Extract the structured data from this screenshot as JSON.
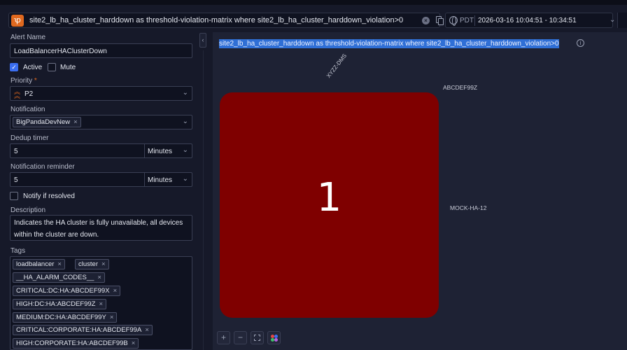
{
  "query": {
    "text": "site2_lb_ha_cluster_harddown as threshold-violation-matrix where site2_lb_ha_cluster_harddown_violation>0"
  },
  "time": {
    "timezone": "PDT",
    "range": "2026-03-16 10:04:51 - 10:34:51"
  },
  "form": {
    "alert_name_label": "Alert Name",
    "alert_name_value": "LoadBalancerHAClusterDown",
    "active_label": "Active",
    "active_checked": true,
    "mute_label": "Mute",
    "mute_checked": false,
    "priority_label": "Priority",
    "priority_required_mark": "*",
    "priority_value": "P2",
    "notification_label": "Notification",
    "notification_chip": "BigPandaDevNew",
    "dedup_label": "Dedup timer",
    "dedup_value": "5",
    "dedup_unit": "Minutes",
    "reminder_label": "Notification reminder",
    "reminder_value": "5",
    "reminder_unit": "Minutes",
    "notify_resolved_label": "Notify if resolved",
    "notify_resolved_checked": false,
    "description_label": "Description",
    "description_value": "Indicates the HA cluster is fully unavailable, all devices within the cluster are down.",
    "tags_label": "Tags",
    "tags": [
      "loadbalancer",
      "cluster",
      "__HA_ALARM_CODES__",
      "CRITICAL:DC:HA:ABCDEF99X",
      "HIGH:DC:HA:ABCDEF99Z",
      "MEDIUM:DC:HA:ABCDEF99Y",
      "CRITICAL:CORPORATE:HA:ABCDEF99A",
      "HIGH:CORPORATE:HA:ABCDEF99B"
    ]
  },
  "matrix": {
    "title": "site2_lb_ha_cluster_harddown as threshold-violation-matrix where site2_lb_ha_cluster_harddown_violation>0",
    "column_label": "XYZZ-DMS",
    "row_label_top": "ABCDEF99Z",
    "row_label_mid": "MOCK-HA-12",
    "cell_value": "1",
    "cell_color": "#7f0000"
  },
  "controls": {
    "zoom_in": "+",
    "zoom_out": "−"
  },
  "colors": {
    "accent": "#e0691f",
    "checkbox": "#3b6ef0",
    "selection": "#2f6fd6"
  }
}
